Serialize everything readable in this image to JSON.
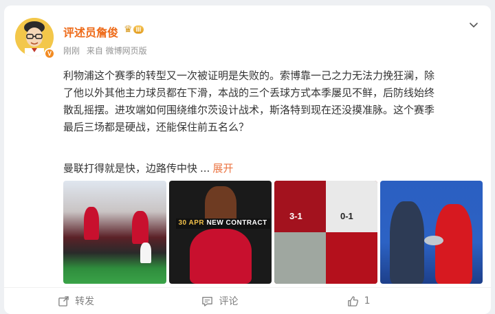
{
  "post": {
    "author": {
      "name": "评述员詹俊",
      "vip_level": "III",
      "verified_badge": "V"
    },
    "meta": {
      "time": "刚刚",
      "source": "来自 微博网页版"
    },
    "body": "利物浦这个赛季的转型又一次被证明是失败的。索博靠一己之力无法力挽狂澜，除\n了他以外其他主力球员都在下滑，本战的三个丢球方式本季屡见不鲜，后防线始终\n散乱摇摆。进攻端如何围绕维尔茨设计战术，斯洛特到现在还没摸准脉。这个赛季\n最后三场都是硬战，还能保住前五名么？",
    "second_line": "曼联打得就是快，边路传中快",
    "ellipsis": "...",
    "expand_label": "展开",
    "images": [
      {
        "name": "celebration-photo"
      },
      {
        "name": "new-contract-photo",
        "banner_day": "30 APR",
        "banner_text": "NEW CONTRACT"
      },
      {
        "name": "scoreline-collage",
        "score_left": "3-1",
        "score_right": "0-1"
      },
      {
        "name": "draw-ceremony-photo"
      }
    ]
  },
  "actions": {
    "repost_label": "转发",
    "comment_label": "评论",
    "like_count": "1"
  },
  "colors": {
    "username": "#ee6c1b",
    "expand": "#eb7340",
    "meta": "#939393"
  }
}
